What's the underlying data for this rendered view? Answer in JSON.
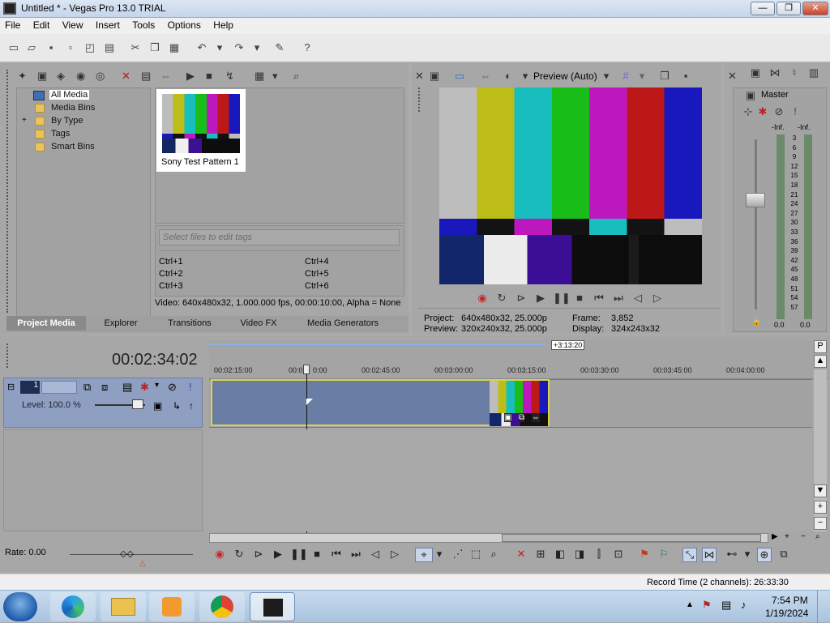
{
  "window": {
    "title": "Untitled * - Vegas Pro 13.0 TRIAL",
    "min": "—",
    "max": "❐",
    "close": "✕"
  },
  "menu": [
    "File",
    "Edit",
    "View",
    "Insert",
    "Tools",
    "Options",
    "Help"
  ],
  "media": {
    "tree": [
      "All Media",
      "Media Bins",
      "By Type",
      "Tags",
      "Smart Bins"
    ],
    "expand_marker": "+",
    "thumbnail_label": "Sony Test Pattern 1",
    "tag_placeholder": "Select files to edit tags",
    "shortcuts": [
      "Ctrl+1",
      "Ctrl+4",
      "Ctrl+2",
      "Ctrl+5",
      "Ctrl+3",
      "Ctrl+6"
    ],
    "info": "Video: 640x480x32, 1.000.000 fps, 00:00:10:00, Alpha = None",
    "tabs": [
      "Project Media",
      "Explorer",
      "Transitions",
      "Video FX",
      "Media Generators"
    ]
  },
  "preview": {
    "mode": "Preview (Auto)",
    "project_label": "Project:",
    "project": "640x480x32, 25.000p",
    "preview_label": "Preview:",
    "preview": "320x240x32, 25.000p",
    "frame_label": "Frame:",
    "frame": "3,852",
    "display_label": "Display:",
    "display": "324x243x32"
  },
  "mixer": {
    "title": "Master",
    "inf_left": "-Inf.",
    "inf_right": "-Inf.",
    "scale": [
      "3",
      "6",
      "9",
      "12",
      "15",
      "18",
      "21",
      "24",
      "27",
      "30",
      "33",
      "36",
      "39",
      "42",
      "45",
      "48",
      "51",
      "54",
      "57"
    ],
    "bottom_left": "0.0",
    "bottom_right": "0.0"
  },
  "timeline": {
    "time": "00:02:34:02",
    "region_end": "+3:13:20",
    "ruler": [
      "00:02:15:00",
      "00:0",
      "0:00",
      "00:02:45:00",
      "00:03:00:00",
      "00:03:15:00",
      "00:03:30:00",
      "00:03:45:00",
      "00:04:00:00"
    ],
    "track_number": "1",
    "level": "Level: 100.0 %",
    "rate": "Rate: 0.00",
    "record_time": "Record Time (2 channels): 26:33:30"
  },
  "taskbar": {
    "time": "7:54 PM",
    "date": "1/19/2024"
  },
  "colors": {
    "bars_top": [
      "#bdbdbd",
      "#bdbd18",
      "#18bdbd",
      "#18bd18",
      "#bd18bd",
      "#bd1818",
      "#1818bd"
    ]
  }
}
